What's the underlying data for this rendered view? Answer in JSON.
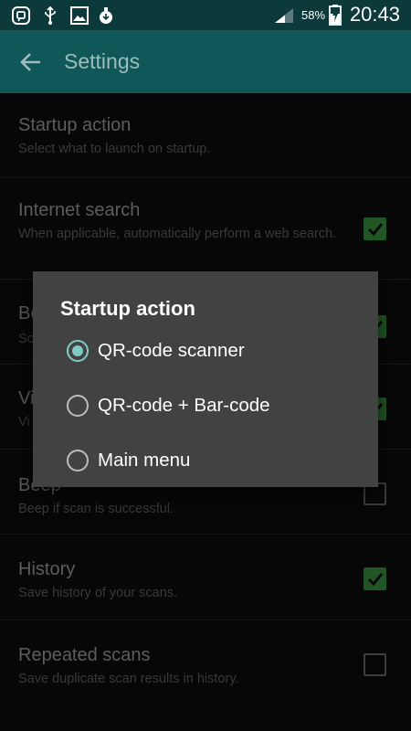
{
  "status_bar": {
    "battery_percent": "58%",
    "time": "20:43",
    "icons": [
      "notification-app-icon",
      "usb-icon",
      "image-icon",
      "download-icon",
      "signal-icon",
      "battery-charging-icon"
    ]
  },
  "app_bar": {
    "title": "Settings",
    "back_icon": "arrow-left-icon"
  },
  "settings": [
    {
      "title": "Startup action",
      "subtitle": "Select what to launch on startup."
    },
    {
      "title": "Internet search",
      "subtitle": "When applicable, automatically perform a web search.",
      "checked": true
    },
    {
      "title": "Be",
      "subtitle": "Sc",
      "checked": true
    },
    {
      "title": "Vi",
      "subtitle": "Vi",
      "checked": true
    },
    {
      "title": "Beep",
      "subtitle": "Beep if scan is successful.",
      "checked": false
    },
    {
      "title": "History",
      "subtitle": "Save history of your scans.",
      "checked": true
    },
    {
      "title": "Repeated scans",
      "subtitle": "Save duplicate scan results in history.",
      "checked": false
    }
  ],
  "dialog": {
    "title": "Startup action",
    "options": [
      {
        "label": "QR-code scanner",
        "selected": true
      },
      {
        "label": "QR-code + Bar-code",
        "selected": false
      },
      {
        "label": "Main menu",
        "selected": false
      }
    ]
  },
  "colors": {
    "status_bar": "#0c3a3b",
    "app_bar": "#105759",
    "checkbox_on": "#1f5623",
    "radio_accent": "#80cbc4",
    "dialog_bg": "#424242"
  }
}
